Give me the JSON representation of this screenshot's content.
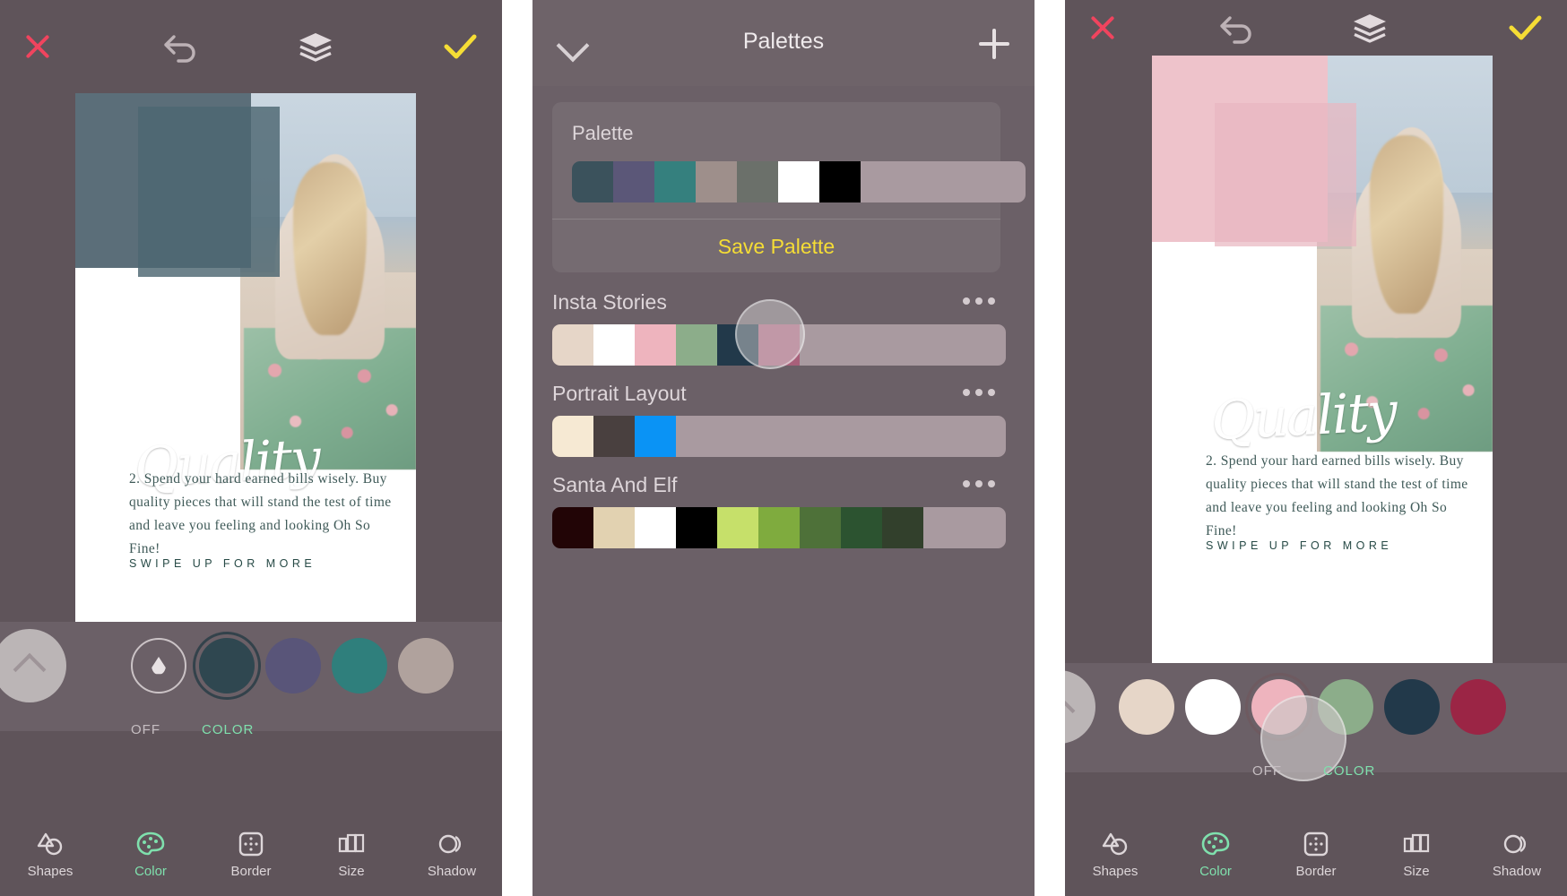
{
  "left_screen": {
    "topbar": {
      "close_icon": "close-icon",
      "undo_icon": "undo-icon",
      "layers_icon": "layers-icon",
      "confirm_icon": "check-icon",
      "close_color": "#f0445e",
      "confirm_color": "#f5dd35"
    },
    "poster": {
      "script_text": "Quality",
      "body_text": "2. Spend your hard earned bills wisely. Buy quality pieces that will stand the test of time and leave you feeling and looking Oh So Fine!",
      "cta_text": "SWIPE UP FOR MORE",
      "shape_color": "#5b6e79",
      "shape_overlay_color": "#4d6671"
    },
    "color_strip": {
      "expand_label": "expand-up-button",
      "eyedropper_label": "droplet-icon",
      "swatches": [
        {
          "name": "swatch-dark-teal",
          "color": "#2f4750",
          "selected": true
        },
        {
          "name": "swatch-slate-purple",
          "color": "#595579",
          "selected": false
        },
        {
          "name": "swatch-teal",
          "color": "#2f7f7c",
          "selected": false
        },
        {
          "name": "swatch-taupe",
          "color": "#b0a29d",
          "selected": false
        }
      ],
      "off_label": "OFF",
      "color_label": "COLOR"
    },
    "bottom_nav": [
      {
        "name": "tab-shapes",
        "label": "Shapes",
        "icon": "shapes-icon",
        "active": false
      },
      {
        "name": "tab-color",
        "label": "Color",
        "icon": "palette-icon",
        "active": true
      },
      {
        "name": "tab-border",
        "label": "Border",
        "icon": "border-icon",
        "active": false
      },
      {
        "name": "tab-size",
        "label": "Size",
        "icon": "size-icon",
        "active": false
      },
      {
        "name": "tab-shadow",
        "label": "Shadow",
        "icon": "shadow-icon",
        "active": false
      }
    ]
  },
  "mid_screen": {
    "header": {
      "title": "Palettes",
      "collapse_icon": "chevron-down-icon",
      "add_icon": "plus-icon"
    },
    "current_palette": {
      "title": "Palette",
      "save_label": "Save Palette",
      "save_color": "#f5dd35",
      "colors": [
        "#3b525c",
        "#5b5778",
        "#35807e",
        "#9e8f8b",
        "#6b706a",
        "#ffffff",
        "#000000",
        "#a99aa0",
        "#a99aa0",
        "#a99aa0",
        "#a99aa0"
      ]
    },
    "groups": [
      {
        "name": "Insta Stories",
        "menu_icon": "more-options-icon",
        "colors": [
          "#e6d6c8",
          "#ffffff",
          "#eeb4be",
          "#8cad8a",
          "#22394a",
          "#a8607a",
          "#a99aa0",
          "#a99aa0",
          "#a99aa0",
          "#a99aa0",
          "#a99aa0"
        ],
        "touch_point_index": 5
      },
      {
        "name": "Portrait Layout",
        "menu_icon": "more-options-icon",
        "colors": [
          "#f6e9d3",
          "#49403f",
          "#0a93f5",
          "#a99aa0",
          "#a99aa0",
          "#a99aa0",
          "#a99aa0",
          "#a99aa0",
          "#a99aa0",
          "#a99aa0",
          "#a99aa0"
        ]
      },
      {
        "name": "Santa And Elf",
        "menu_icon": "more-options-icon",
        "colors": [
          "#220506",
          "#e2d2b1",
          "#ffffff",
          "#000000",
          "#c6e06a",
          "#7fab3e",
          "#4e7139",
          "#2c5330",
          "#32402c",
          "#a99aa0",
          "#a99aa0"
        ]
      }
    ]
  },
  "right_screen": {
    "topbar": {
      "close_icon": "close-icon",
      "undo_icon": "undo-icon",
      "layers_icon": "layers-icon",
      "confirm_icon": "check-icon",
      "close_color": "#f0445e",
      "confirm_color": "#f5dd35"
    },
    "poster": {
      "script_text": "Quality",
      "body_text": "2. Spend your hard earned bills wisely. Buy quality pieces that will stand the test of time and leave you feeling and looking Oh So Fine!",
      "cta_text": "SWIPE UP FOR MORE",
      "shape_color": "#eec3cb",
      "shape_overlay_color": "#e9b7c0"
    },
    "color_strip": {
      "expand_label": "expand-up-button",
      "swatches": [
        {
          "name": "swatch-cream",
          "color": "#e6d6c8",
          "selected": false
        },
        {
          "name": "swatch-white",
          "color": "#ffffff",
          "selected": false
        },
        {
          "name": "swatch-pink",
          "color": "#eeb4be",
          "selected": true
        },
        {
          "name": "swatch-green",
          "color": "#8cad8a",
          "selected": false
        },
        {
          "name": "swatch-navy",
          "color": "#22394a",
          "selected": false
        },
        {
          "name": "swatch-wine",
          "color": "#9b2545",
          "selected": false
        }
      ],
      "off_label": "OFF",
      "color_label": "COLOR"
    },
    "bottom_nav": [
      {
        "name": "tab-shapes",
        "label": "Shapes",
        "icon": "shapes-icon",
        "active": false
      },
      {
        "name": "tab-color",
        "label": "Color",
        "icon": "palette-icon",
        "active": true
      },
      {
        "name": "tab-border",
        "label": "Border",
        "icon": "border-icon",
        "active": false
      },
      {
        "name": "tab-size",
        "label": "Size",
        "icon": "size-icon",
        "active": false
      },
      {
        "name": "tab-shadow",
        "label": "Shadow",
        "icon": "shadow-icon",
        "active": false
      }
    ]
  }
}
